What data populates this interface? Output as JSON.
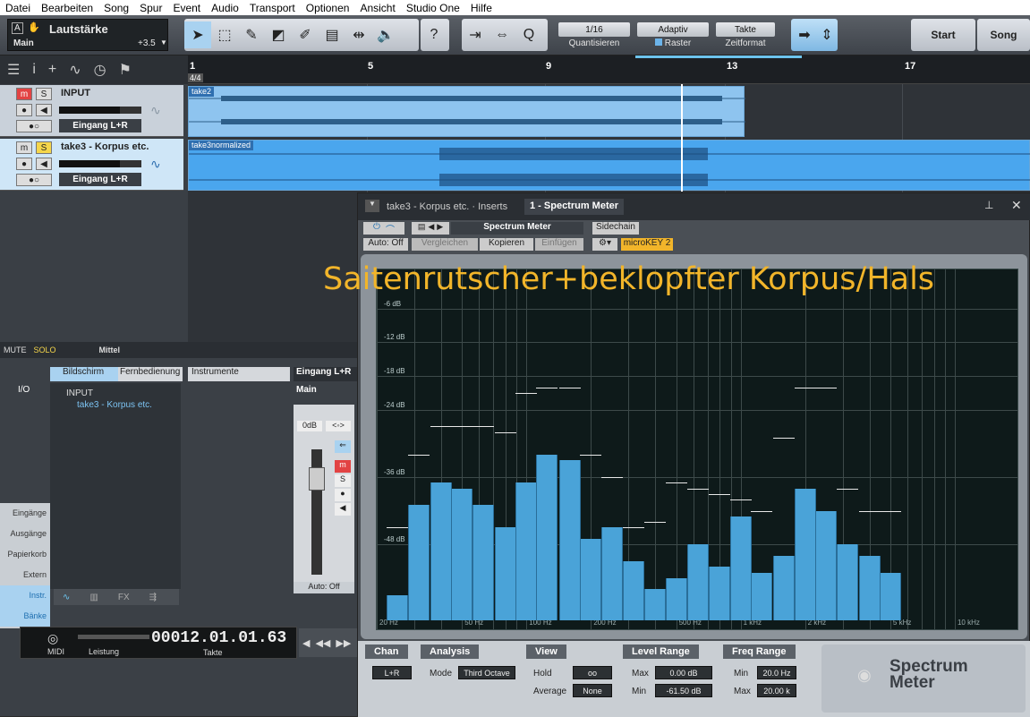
{
  "menu": [
    "Datei",
    "Bearbeiten",
    "Song",
    "Spur",
    "Event",
    "Audio",
    "Transport",
    "Optionen",
    "Ansicht",
    "Studio One",
    "Hilfe"
  ],
  "volume": {
    "title": "Lautstärke",
    "bus": "Main",
    "value": "+3.5"
  },
  "quantize": {
    "value": "1/16",
    "label": "Quantisieren"
  },
  "raster": {
    "value": "Adaptiv",
    "label": "Raster"
  },
  "timeformat": {
    "value": "Takte",
    "label": "Zeitformat"
  },
  "page_buttons": {
    "start": "Start",
    "song": "Song"
  },
  "ruler": {
    "marks": [
      "1",
      "5",
      "9",
      "13",
      "17"
    ],
    "timesig": "4/4"
  },
  "tracks": [
    {
      "name": "INPUT",
      "mute": "m",
      "solo": "S",
      "input": "Eingang L+R"
    },
    {
      "name": "take3 - Korpus etc.",
      "mute": "m",
      "solo": "S",
      "input": "Eingang L+R"
    }
  ],
  "clips": {
    "take2": "take2",
    "take3": "take3normalized"
  },
  "mixer": {
    "mute": "MUTE",
    "solo": "SOLO",
    "mid": "Mittel"
  },
  "browser": {
    "tab_screen": "Bildschirm",
    "tab_remote": "Fernbedienung",
    "instruments": "Instrumente",
    "channel": "Eingang L+R",
    "main": "Main",
    "items": [
      "INPUT",
      "take3 - Korpus etc."
    ],
    "io": "I/O",
    "nav": [
      "Eingänge",
      "Ausgänge",
      "Papierkorb",
      "Extern",
      "Instr.",
      "Bänke"
    ],
    "fx": "FX",
    "db": "0dB",
    "auto": "Auto: Off",
    "chan_m": "m",
    "chan_s": "S"
  },
  "transport": {
    "time": "00012.01.01.63",
    "unit": "Takte",
    "midi": "MIDI",
    "perf": "Leistung"
  },
  "plugin": {
    "title": "take3 - Korpus etc. · Inserts",
    "tab": "1 - Spectrum Meter",
    "preset": "Spectrum Meter",
    "sidechain": "Sidechain",
    "auto": "Auto: Off",
    "compare": "Vergleichen",
    "copy": "Kopieren",
    "paste": "Einfügen",
    "microkey": "microKEY 2"
  },
  "overlay_text": "Saitenrutscher+beklopfter Korpus/Hals",
  "chart_data": {
    "type": "bar",
    "y_labels": [
      "-6 dB",
      "-12 dB",
      "-18 dB",
      "-24 dB",
      "-36 dB",
      "-48 dB"
    ],
    "x_labels": [
      "20 Hz",
      "50 Hz",
      "100 Hz",
      "200 Hz",
      "500 Hz",
      "1 kHz",
      "2 kHz",
      "5 kHz",
      "10 kHz"
    ],
    "ylim": [
      -61.5,
      0
    ],
    "xlim": [
      20,
      20000
    ],
    "x_scale": "log",
    "bands_hz": [
      25,
      31.5,
      40,
      50,
      63,
      80,
      100,
      125,
      160,
      200,
      250,
      315,
      400,
      500,
      630,
      800,
      1000,
      1250,
      1600,
      2000,
      2500,
      3150,
      4000,
      5000
    ],
    "values_db": [
      -57,
      -41,
      -37,
      -38,
      -41,
      -45,
      -37,
      -32,
      -33,
      -47,
      -45,
      -51,
      -56,
      -54,
      -48,
      -52,
      -43,
      -53,
      -50,
      -38,
      -42,
      -48,
      -50,
      -53
    ],
    "peaks_db": [
      -45,
      -32,
      -27,
      -27,
      -27,
      -28,
      -21,
      -20,
      -20,
      -32,
      -36,
      -45,
      -44,
      -37,
      -38,
      -39,
      -40,
      -42,
      -29,
      -20,
      -20,
      -38,
      -42,
      -42
    ]
  },
  "panels": {
    "chan": {
      "title": "Chan",
      "value": "L+R"
    },
    "analysis": {
      "title": "Analysis",
      "mode_label": "Mode",
      "mode": "Third Octave"
    },
    "view": {
      "title": "View",
      "hold_label": "Hold",
      "hold": "oo",
      "avg_label": "Average",
      "avg": "None"
    },
    "level": {
      "title": "Level Range",
      "max_label": "Max",
      "max": "0.00 dB",
      "min_label": "Min",
      "min": "-61.50 dB"
    },
    "freq": {
      "title": "Freq Range",
      "min_label": "Min",
      "min": "20.0 Hz",
      "max_label": "Max",
      "max": "20.00 k"
    },
    "logo": "Spectrum Meter"
  }
}
